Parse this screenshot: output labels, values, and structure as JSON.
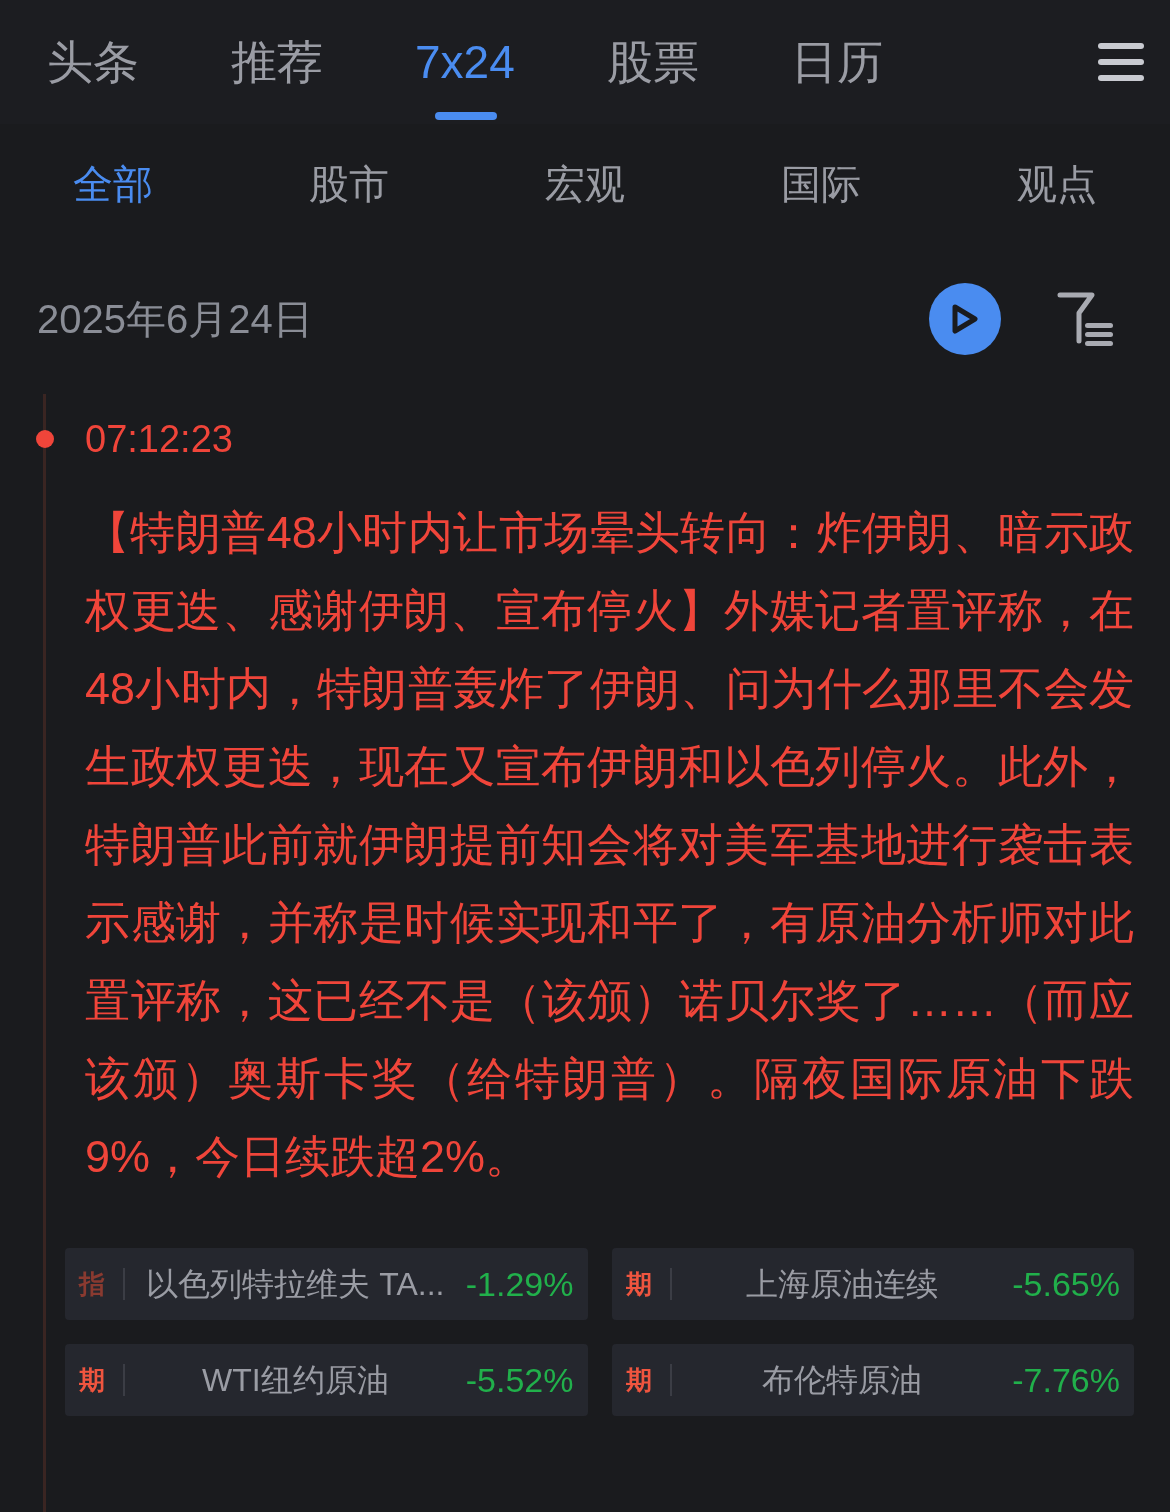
{
  "nav_tabs": [
    {
      "label": "头条",
      "selected": false
    },
    {
      "label": "推荐",
      "selected": false
    },
    {
      "label": "7x24",
      "selected": true
    },
    {
      "label": "股票",
      "selected": false
    },
    {
      "label": "日历",
      "selected": false
    }
  ],
  "sub_tabs": [
    {
      "label": "全部",
      "selected": true
    },
    {
      "label": "股市",
      "selected": false
    },
    {
      "label": "宏观",
      "selected": false
    },
    {
      "label": "国际",
      "selected": false
    },
    {
      "label": "观点",
      "selected": false
    }
  ],
  "date": "2025年6月24日",
  "news": {
    "time": "07:12:23",
    "text": "【特朗普48小时内让市场晕头转向：炸伊朗、暗示政权更迭、感谢伊朗、宣布停火】外媒记者置评称，在48小时内，特朗普轰炸了伊朗、问为什么那里不会发生政权更迭，现在又宣布伊朗和以色列停火。此外，特朗普此前就伊朗提前知会将对美军基地进行袭击表示感谢，并称是时候实现和平了，有原油分析师对此置评称，这已经不是（该颁）诺贝尔奖了……（而应该颁）奥斯卡奖（给特朗普）。隔夜国际原油下跌9%，今日续跌超2%。",
    "quotes": [
      {
        "tag": "指",
        "color": "#8a3a30",
        "name": "以色列特拉维夫 TA...",
        "change": "-1.29%"
      },
      {
        "tag": "期",
        "color": "#f0553f",
        "name": "上海原油连续",
        "change": "-5.65%"
      },
      {
        "tag": "期",
        "color": "#f0553f",
        "name": "WTI纽约原油",
        "change": "-5.52%"
      },
      {
        "tag": "期",
        "color": "#f0553f",
        "name": "布伦特原油",
        "change": "-7.76%"
      }
    ]
  }
}
